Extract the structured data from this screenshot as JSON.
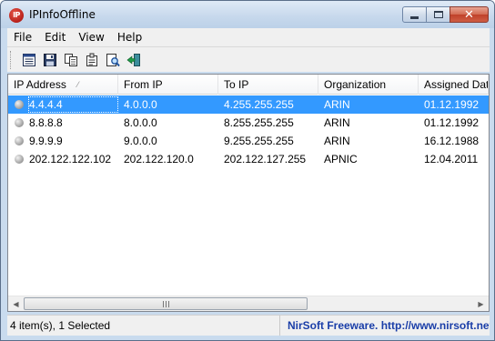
{
  "window": {
    "title": "IPInfoOffline",
    "icon_text": "IP",
    "icon": "app-icon",
    "controls": [
      "minimize-icon",
      "maximize-icon",
      "close-icon"
    ],
    "close_glyph": "✕"
  },
  "menu": {
    "items": [
      "File",
      "Edit",
      "View",
      "Help"
    ]
  },
  "toolbar": {
    "buttons": [
      "report-icon",
      "save-icon",
      "copy-icon",
      "properties-icon",
      "find-icon",
      "exit-icon"
    ]
  },
  "list": {
    "columns": [
      "IP Address",
      "From IP",
      "To IP",
      "Organization",
      "Assigned Dat"
    ],
    "sort_indicator": "⁄",
    "rows": [
      {
        "ip": "4.4.4.4",
        "from": "4.0.0.0",
        "to": "4.255.255.255",
        "org": "ARIN",
        "date": "01.12.1992",
        "selected": true
      },
      {
        "ip": "8.8.8.8",
        "from": "8.0.0.0",
        "to": "8.255.255.255",
        "org": "ARIN",
        "date": "01.12.1992",
        "selected": false
      },
      {
        "ip": "9.9.9.9",
        "from": "9.0.0.0",
        "to": "9.255.255.255",
        "org": "ARIN",
        "date": "16.12.1988",
        "selected": false
      },
      {
        "ip": "202.122.122.102",
        "from": "202.122.120.0",
        "to": "202.122.127.255",
        "org": "APNIC",
        "date": "12.04.2011",
        "selected": false
      }
    ]
  },
  "scrollbar": {
    "left_arrow": "◀",
    "right_arrow": "▶"
  },
  "status": {
    "count": "4 item(s), 1 Selected",
    "credit": "NirSoft Freeware.  http://www.nirsoft.net"
  },
  "colors": {
    "selection": "#3399ff",
    "link": "#1a3ea8"
  }
}
